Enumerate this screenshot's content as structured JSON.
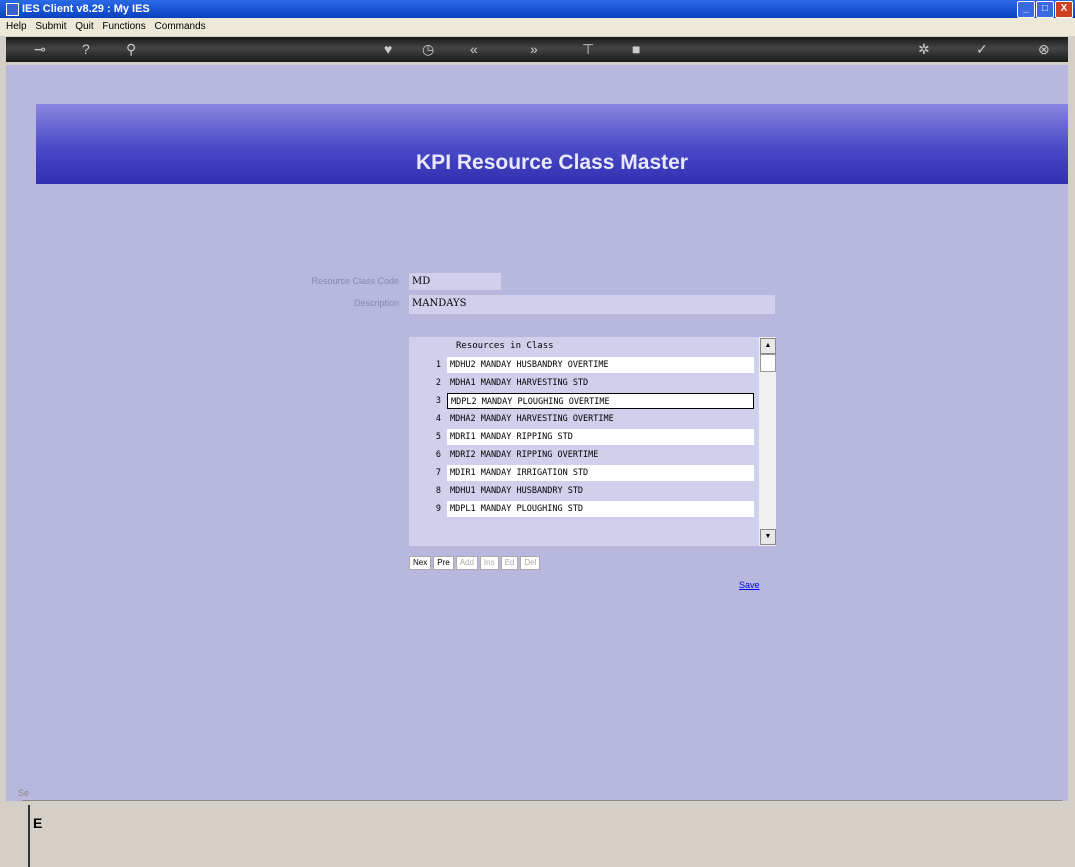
{
  "window": {
    "title": "IES Client v8.29 : My IES",
    "controls": {
      "minimize": "_",
      "maximize": "□",
      "close": "X"
    }
  },
  "menu": [
    "Help",
    "Submit",
    "Quit",
    "Functions",
    "Commands"
  ],
  "toolbar_icons": [
    "key-icon",
    "help-icon",
    "search-icon",
    "heart-icon",
    "clock-icon",
    "back-icon",
    "forward-icon",
    "filter-icon",
    "stop-icon",
    "settings-icon",
    "check-icon",
    "close-icon"
  ],
  "header": {
    "title": "KPI Resource Class Master"
  },
  "form": {
    "code_label": "Resource Class Code",
    "code_value": "MD",
    "desc_label": "Description",
    "desc_value": "MANDAYS"
  },
  "grid": {
    "header": "Resources in Class",
    "rows": [
      {
        "num": "1",
        "text": "MDHU2 MANDAY HUSBANDRY OVERTIME"
      },
      {
        "num": "2",
        "text": "MDHA1 MANDAY HARVESTING STD"
      },
      {
        "num": "3",
        "text": "MDPL2 MANDAY PLOUGHING OVERTIME"
      },
      {
        "num": "4",
        "text": "MDHA2 MANDAY HARVESTING OVERTIME"
      },
      {
        "num": "5",
        "text": "MDRI1 MANDAY RIPPING STD"
      },
      {
        "num": "6",
        "text": "MDRI2 MANDAY RIPPING OVERTIME"
      },
      {
        "num": "7",
        "text": "MDIR1 MANDAY IRRIGATION STD"
      },
      {
        "num": "8",
        "text": "MDHU1 MANDAY HUSBANDRY STD"
      },
      {
        "num": "9",
        "text": "MDPL1 MANDAY PLOUGHING STD"
      }
    ],
    "buttons": [
      "Nex",
      "Pre",
      "Add",
      "Ins",
      "Ed",
      "Del"
    ]
  },
  "save_label": "Save",
  "side": {
    "sel_label": "Se",
    "e_label": "E"
  }
}
